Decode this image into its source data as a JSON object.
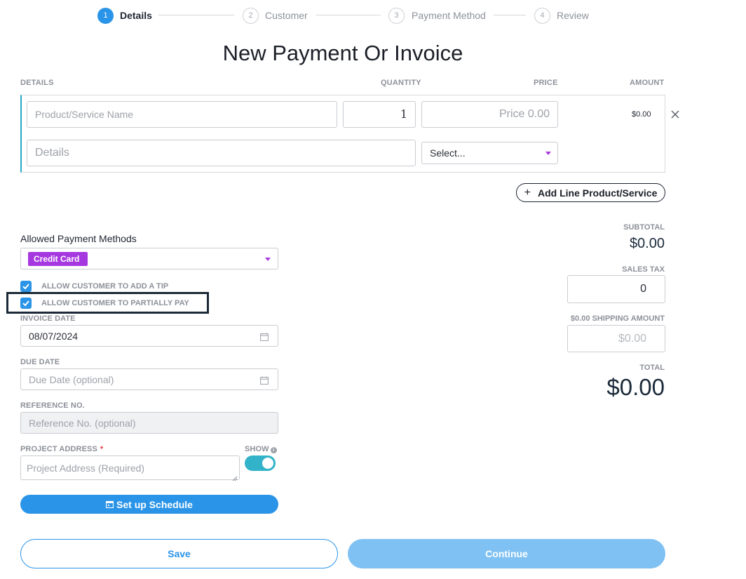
{
  "stepper": {
    "steps": [
      {
        "number": "1",
        "label": "Details",
        "state": "active"
      },
      {
        "number": "2",
        "label": "Customer",
        "state": "inactive"
      },
      {
        "number": "3",
        "label": "Payment Method",
        "state": "inactive"
      },
      {
        "number": "4",
        "label": "Review",
        "state": "inactive"
      }
    ]
  },
  "page_title": "New Payment Or Invoice",
  "line_items": {
    "headers": {
      "details": "DETAILS",
      "quantity": "QUANTITY",
      "price": "PRICE",
      "amount": "AMOUNT"
    },
    "row": {
      "name_placeholder": "Product/Service Name",
      "quantity": "1",
      "price_placeholder": "Price 0.00",
      "amount": "$0.00",
      "details_placeholder": "Details",
      "select_value": "Select..."
    },
    "add_line_label": "Add Line Product/Service"
  },
  "payment_methods": {
    "label": "Allowed Payment Methods",
    "selected": [
      "Credit Card"
    ]
  },
  "options": {
    "allow_tip": {
      "label": "ALLOW CUSTOMER TO ADD A TIP",
      "checked": true
    },
    "allow_partial": {
      "label": "ALLOW CUSTOMER TO PARTIALLY PAY",
      "checked": true
    }
  },
  "invoice_date": {
    "label": "INVOICE DATE",
    "value": "08/07/2024"
  },
  "due_date": {
    "label": "DUE DATE",
    "placeholder": "Due Date (optional)"
  },
  "reference": {
    "label": "REFERENCE NO.",
    "placeholder": "Reference No. (optional)"
  },
  "project_address": {
    "label": "PROJECT ADDRESS",
    "required_mark": "*",
    "placeholder": "Project Address (Required)"
  },
  "show_toggle": {
    "label": "SHOW",
    "on": true
  },
  "schedule_button": "Set up Schedule",
  "summary": {
    "subtotal_label": "SUBTOTAL",
    "subtotal_value": "$0.00",
    "sales_tax_label": "SALES TAX",
    "sales_tax_value": "0",
    "shipping_label": "$0.00 SHIPPING AMOUNT",
    "shipping_placeholder": "$0.00",
    "total_label": "TOTAL",
    "total_value": "$0.00"
  },
  "buttons": {
    "save": "Save",
    "continue": "Continue"
  },
  "colors": {
    "accent": "#2a94e8",
    "payment_pill": "#a638e0",
    "toggle_on": "#32b3c9",
    "continue_disabled": "#7fc1f3"
  }
}
